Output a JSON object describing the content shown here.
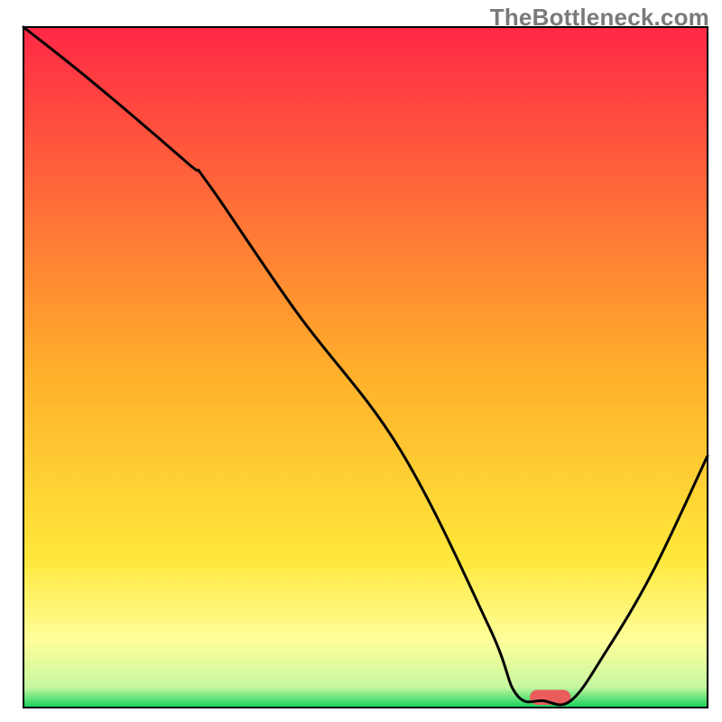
{
  "watermark": "TheBottleneck.com",
  "chart_data": {
    "type": "line",
    "title": "",
    "xlabel": "",
    "ylabel": "",
    "xlim": [
      0,
      100
    ],
    "ylim": [
      0,
      100
    ],
    "axes_visible": false,
    "grid": false,
    "legend": false,
    "background_gradient": {
      "stops": [
        {
          "offset": 0.0,
          "color": "#ff2846"
        },
        {
          "offset": 0.5,
          "color": "#ffae2b"
        },
        {
          "offset": 0.78,
          "color": "#ffe73a"
        },
        {
          "offset": 0.9,
          "color": "#ffff9a"
        },
        {
          "offset": 0.97,
          "color": "#c7f7a0"
        },
        {
          "offset": 1.0,
          "color": "#12d15b"
        }
      ]
    },
    "series": [
      {
        "name": "bottleneck-curve",
        "color": "#000000",
        "x": [
          0,
          10,
          24,
          27,
          40,
          55,
          68,
          72,
          76,
          80,
          85,
          92,
          100
        ],
        "y": [
          100,
          92,
          80,
          77,
          58,
          38,
          12,
          2,
          1,
          1,
          8,
          20,
          37
        ]
      }
    ],
    "markers": [
      {
        "name": "optimal-range-pill",
        "shape": "rounded-rect",
        "color": "#ea5d5d",
        "x_center": 77,
        "y_center": 1.5,
        "width": 6,
        "height": 2.2,
        "rx_percent_of_height": 50
      }
    ],
    "frame": {
      "visible": true,
      "color": "#000000",
      "line_width": 2
    }
  }
}
